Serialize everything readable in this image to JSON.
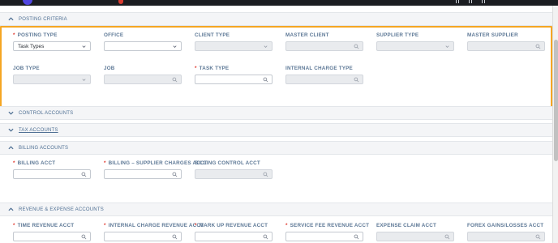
{
  "sections": {
    "posting_criteria": "POSTING CRITERIA",
    "control_accounts": "CONTROL ACCOUNTS",
    "tax_accounts": "TAX ACCOUNTS",
    "billing_accounts": "BILLING ACCOUNTS",
    "revenue_expense_accounts": "REVENUE & EXPENSE ACCOUNTS"
  },
  "posting_criteria": {
    "posting_type": {
      "label": "POSTING TYPE",
      "value": "Task Types"
    },
    "office": {
      "label": "OFFICE"
    },
    "client_type": {
      "label": "CLIENT TYPE"
    },
    "master_client": {
      "label": "MASTER CLIENT"
    },
    "supplier_type": {
      "label": "SUPPLIER TYPE"
    },
    "master_supplier": {
      "label": "MASTER SUPPLIER"
    },
    "job_type": {
      "label": "JOB TYPE"
    },
    "job": {
      "label": "JOB"
    },
    "task_type": {
      "label": "TASK TYPE"
    },
    "internal_charge_type": {
      "label": "INTERNAL CHARGE TYPE"
    }
  },
  "billing_accounts": {
    "billing_acct": {
      "label": "BILLING ACCT"
    },
    "billing_supplier_charges_acct": {
      "label": "BILLING – SUPPLIER CHARGES ACCT"
    },
    "billing_control_acct": {
      "label": "BILLING CONTROL ACCT"
    }
  },
  "revenue_expense_accounts": {
    "time_revenue_acct": {
      "label": "TIME REVENUE ACCT"
    },
    "internal_charge_revenue_acct": {
      "label": "INTERNAL CHARGE REVENUE ACCT"
    },
    "mark_up_revenue_acct": {
      "label": "MARK UP REVENUE ACCT"
    },
    "service_fee_revenue_acct": {
      "label": "SERVICE FEE REVENUE ACCT"
    },
    "expense_claim_acct": {
      "label": "EXPENSE CLAIM ACCT"
    },
    "forex_gains_losses_acct": {
      "label": "FOREX GAINS/LOSSES ACCT"
    }
  }
}
